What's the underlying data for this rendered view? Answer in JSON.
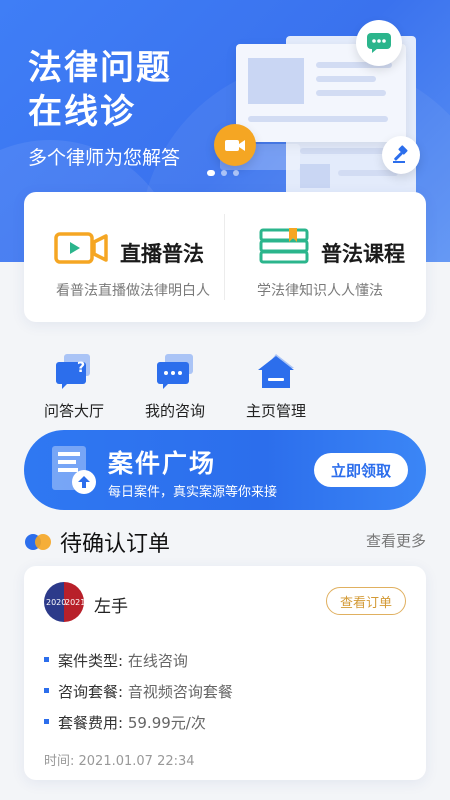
{
  "hero": {
    "title_line1": "法律问题",
    "title_line2": "在线诊",
    "subtitle": "多个律师为您解答"
  },
  "features": [
    {
      "title": "直播普法",
      "desc": "看普法直播做法律明白人",
      "icon": "video-camera-icon"
    },
    {
      "title": "普法课程",
      "desc": "学法律知识人人懂法",
      "icon": "books-icon"
    }
  ],
  "quick_actions": [
    {
      "label": "问答大厅",
      "icon": "question-chat-icon"
    },
    {
      "label": "我的咨询",
      "icon": "chat-bubbles-icon"
    },
    {
      "label": "主页管理",
      "icon": "home-icon"
    }
  ],
  "banner": {
    "title": "案件广场",
    "subtitle": "每日案件，真实案源等你来接",
    "button": "立即领取"
  },
  "orders_section": {
    "title": "待确认订单",
    "more": "查看更多"
  },
  "order": {
    "avatar_text_left": "2020",
    "avatar_text_right": "2021",
    "username": "左手",
    "view_button": "查看订单",
    "case_type_label": "案件类型:",
    "case_type_value": "在线咨询",
    "package_label": "咨询套餐:",
    "package_value": "音视频咨询套餐",
    "fee_label": "套餐费用:",
    "fee_value": "59.99元/次",
    "time": "时间: 2021.01.07 22:34"
  },
  "colors": {
    "brand_blue": "#2c6eec",
    "accent_orange": "#f5a623",
    "accent_green": "#2bb58c"
  }
}
